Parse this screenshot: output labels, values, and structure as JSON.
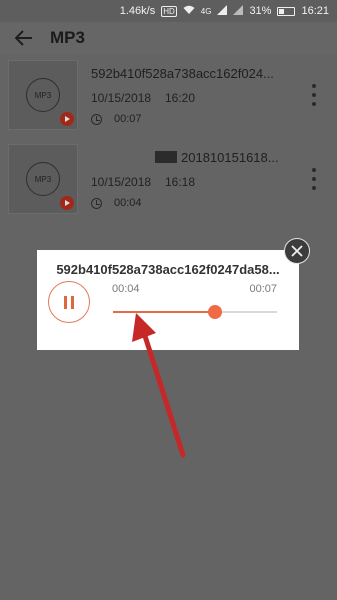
{
  "status_bar": {
    "speed": "1.46k/s",
    "hd": "HD",
    "network": "4G",
    "battery": "31%",
    "time": "16:21"
  },
  "app_bar": {
    "title": "MP3"
  },
  "files": [
    {
      "name": "592b410f528a738acc162f024...",
      "thumb_label": "MP3",
      "date": "10/15/2018",
      "time": "16:20",
      "duration": "00:07"
    },
    {
      "name": "201810151618...",
      "thumb_label": "MP3",
      "date": "10/15/2018",
      "time": "16:18",
      "duration": "00:04"
    }
  ],
  "player": {
    "title": "592b410f528a738acc162f0247da58...",
    "current_time": "00:04",
    "total_time": "00:07",
    "progress": 0.62
  },
  "colors": {
    "accent": "#f06a45",
    "annotation": "#c62828"
  }
}
